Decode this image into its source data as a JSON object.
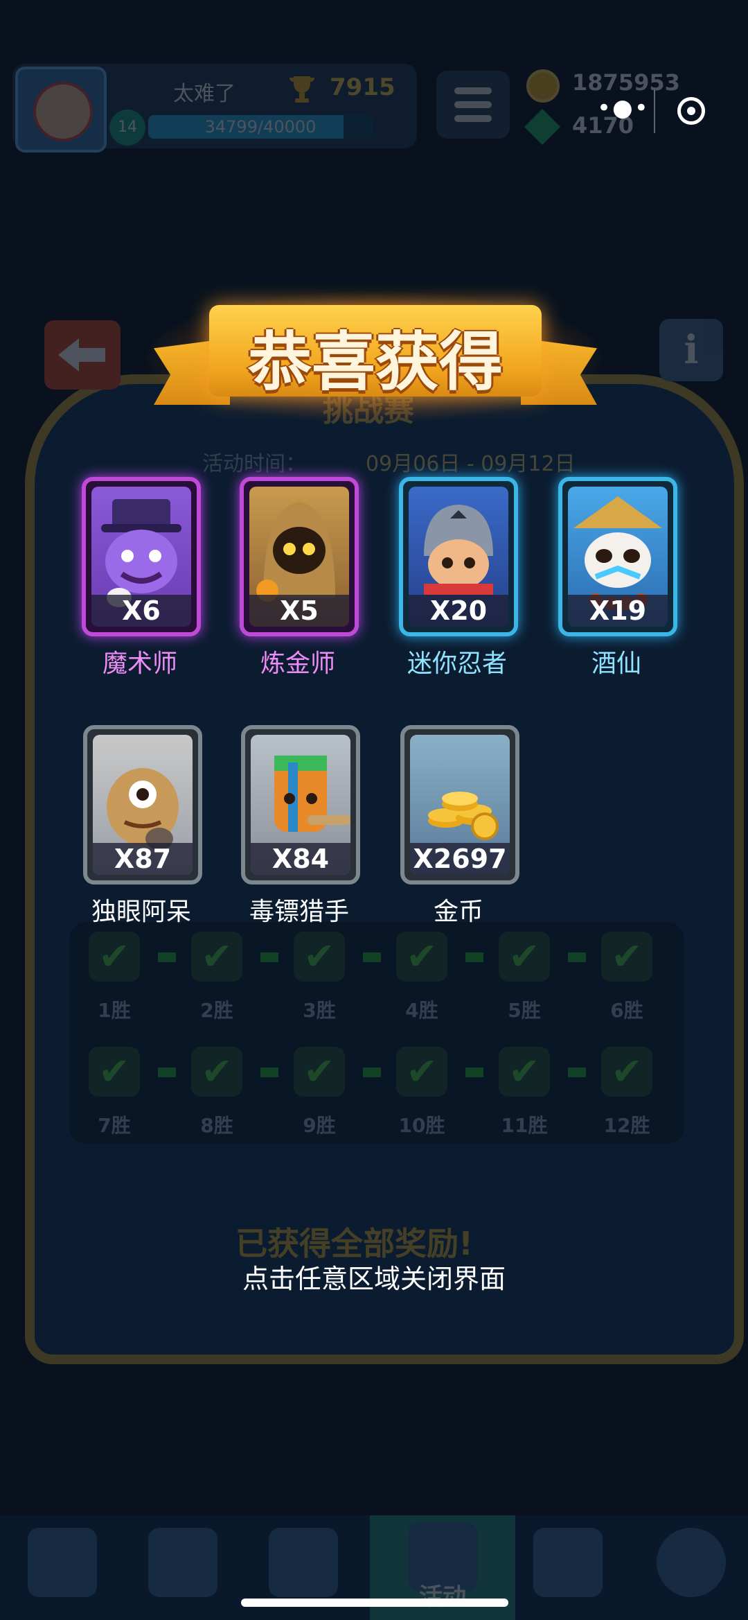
{
  "background": {
    "player_name": "太难了",
    "trophies": "7915",
    "level": "14",
    "xp_text": "34799/40000",
    "xp_fraction": 0.87,
    "coins": "1875953",
    "gems": "4170",
    "screen_title": "挑战赛",
    "event_time_label": "活动时间：",
    "event_time_value": "09月06日 - 09月12日",
    "win_steps": [
      "1胜",
      "2胜",
      "3胜",
      "4胜",
      "5胜",
      "6胜",
      "7胜",
      "8胜",
      "9胜",
      "10胜",
      "11胜",
      "12胜"
    ],
    "all_claimed": "已获得全部奖励!",
    "nav_active_label": "活动"
  },
  "modal": {
    "title": "恭喜获得",
    "close_hint": "点击任意区域关闭界面",
    "rewards": [
      {
        "name": "魔术师",
        "qty": "X6",
        "rarity": "epic"
      },
      {
        "name": "炼金师",
        "qty": "X5",
        "rarity": "epic"
      },
      {
        "name": "迷你忍者",
        "qty": "X20",
        "rarity": "rare"
      },
      {
        "name": "酒仙",
        "qty": "X19",
        "rarity": "rare"
      },
      {
        "name": "独眼阿呆",
        "qty": "X87",
        "rarity": "common"
      },
      {
        "name": "毒镖猎手",
        "qty": "X84",
        "rarity": "common"
      },
      {
        "name": "金币",
        "qty": "X2697",
        "rarity": "common"
      }
    ]
  },
  "colors": {
    "epic": "#c04ad8",
    "rare": "#3bb6e6",
    "common": "#7d8790",
    "ribbon": "#f2a51f"
  }
}
